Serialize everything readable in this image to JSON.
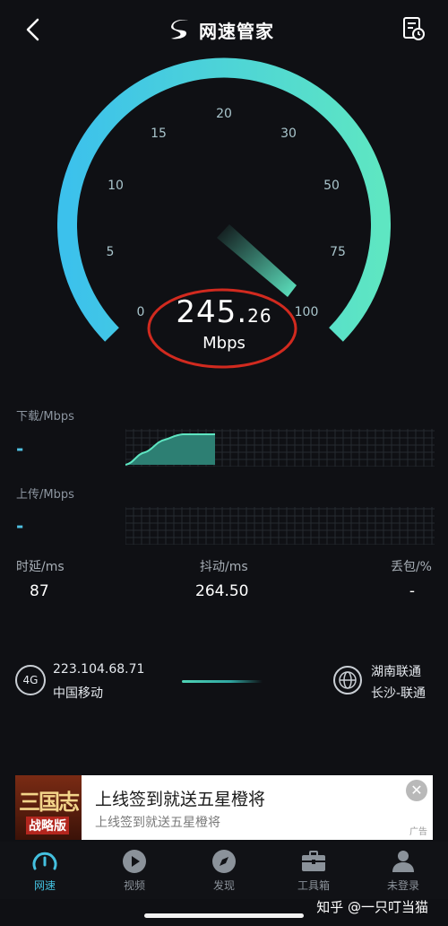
{
  "header": {
    "title": "网速管家",
    "back_icon": "chevron-left-icon",
    "history_icon": "report-history-icon"
  },
  "gauge": {
    "ticks": [
      "0",
      "5",
      "10",
      "15",
      "20",
      "30",
      "50",
      "75",
      "100"
    ],
    "speed_int": "245.",
    "speed_dec": "26",
    "unit": "Mbps",
    "needle_value": "100",
    "arc_colors": [
      "#3cc1ec",
      "#5ee6c2"
    ],
    "highlight_color": "#d12a1f"
  },
  "metrics": {
    "download_label": "下载/Mbps",
    "download_value": "-",
    "upload_label": "上传/Mbps",
    "upload_value": "-",
    "download_progress": 0.29
  },
  "stats": {
    "latency_label": "时延/ms",
    "latency_value": "87",
    "jitter_label": "抖动/ms",
    "jitter_value": "264.50",
    "loss_label": "丢包/%",
    "loss_value": "-"
  },
  "network": {
    "badge": "4G",
    "ip": "223.104.68.71",
    "carrier": "中国移动",
    "server_name": "湖南联通",
    "server_location": "长沙-联通"
  },
  "ad": {
    "thumb_title": "三国志",
    "thumb_sub": "战略版",
    "title": "上线签到就送五星橙将",
    "subtitle": "上线签到就送五星橙将",
    "close": "✕",
    "tag": "广告"
  },
  "nav": {
    "items": [
      {
        "label": "网速",
        "icon": "speedometer-icon"
      },
      {
        "label": "视频",
        "icon": "play-icon"
      },
      {
        "label": "发现",
        "icon": "compass-icon"
      },
      {
        "label": "工具箱",
        "icon": "toolbox-icon"
      },
      {
        "label": "未登录",
        "icon": "user-icon"
      }
    ]
  },
  "watermark": "知乎 @一只叮当猫"
}
